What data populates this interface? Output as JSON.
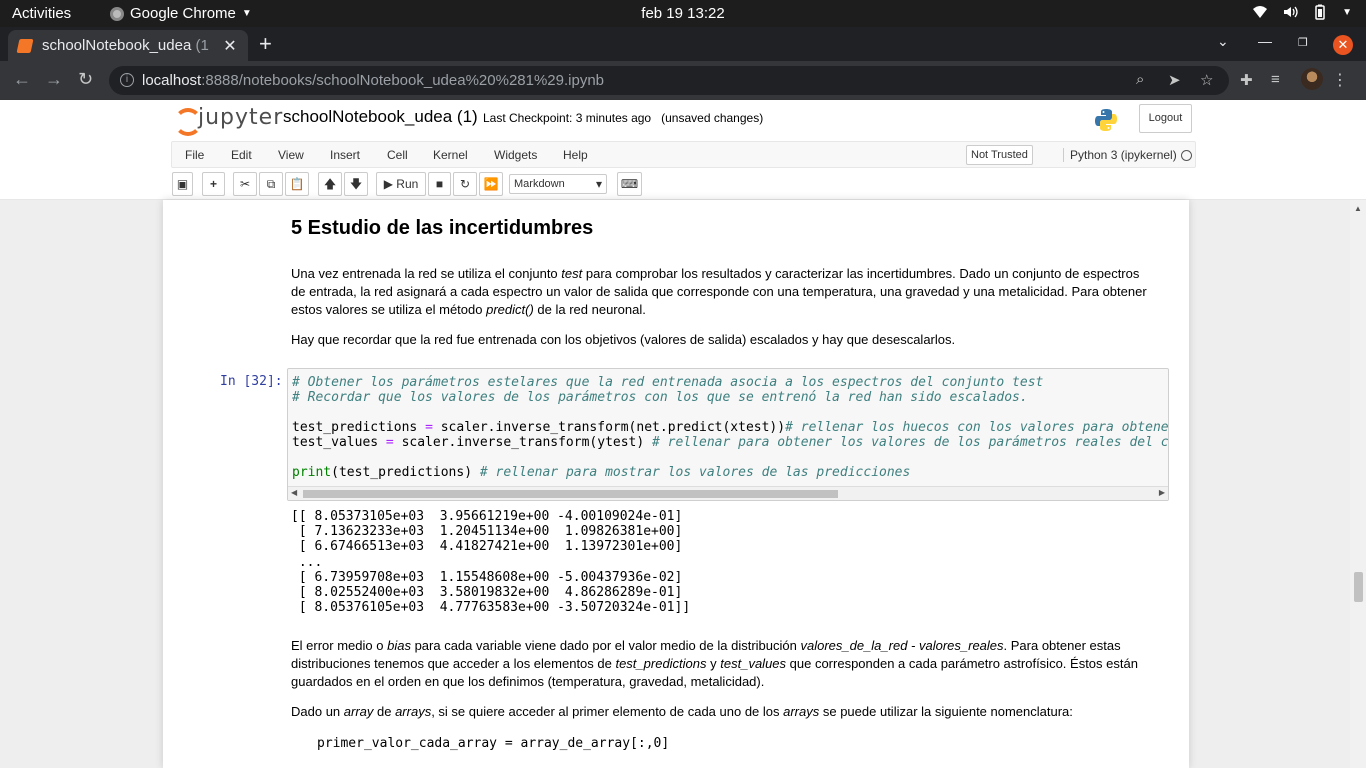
{
  "os": {
    "activities": "Activities",
    "app_name": "Google Chrome",
    "clock": "feb 19  13:22"
  },
  "browser": {
    "tab_title": "schoolNotebook_udea",
    "tab_title_dim": "(1",
    "url_host": "localhost",
    "url_path": ":8888/notebooks/schoolNotebook_udea%20%281%29.ipynb"
  },
  "jupyter": {
    "logo_word": "jupyter",
    "notebook_name": "schoolNotebook_udea (1)",
    "checkpoint": "Last Checkpoint: 3 minutes ago",
    "unsaved": "(unsaved changes)",
    "logout": "Logout",
    "menu": [
      "File",
      "Edit",
      "View",
      "Insert",
      "Cell",
      "Kernel",
      "Widgets",
      "Help"
    ],
    "not_trusted": "Not Trusted",
    "kernel": "Python 3 (ipykernel)",
    "run_label": "Run",
    "cell_type": "Markdown"
  },
  "notebook": {
    "heading": "5 Estudio de las incertidumbres",
    "p1_a": "Una vez entrenada la red se utiliza el conjunto ",
    "p1_em": "test",
    "p1_b": " para comprobar los resultados y caracterizar las incertidumbres. Dado un conjunto de espectros de entrada, la red asignará a cada espectro un valor de salida que corresponde con una temperatura, una gravedad y una metalicidad. Para obtener estos valores se utiliza el método ",
    "p1_em2": "predict()",
    "p1_c": " de la red neuronal.",
    "p2": "Hay que recordar que la red fue entrenada con los objetivos (valores de salida) escalados y hay que desescalarlos.",
    "prompt": "In [32]:",
    "code": {
      "l1": "# Obtener los parámetros estelares que la red entrenada asocia a los espectros del conjunto test",
      "l2": "# Recordar que los valores de los parámetros con los que se entrenó la red han sido escalados.",
      "l3a": "test_predictions ",
      "l3op": "=",
      "l3b": " scaler.inverse_transform(net.predict(xtest))",
      "l3c": "# rellenar los huecos con los valores para obtener la",
      "l4a": "test_values ",
      "l4op": "=",
      "l4b": " scaler.inverse_transform(ytest) ",
      "l4c": "# rellenar para obtener los valores de los parámetros reales del conju",
      "l5kw": "print",
      "l5b": "(test_predictions) ",
      "l5c": "# rellenar para mostrar los valores de las predicciones"
    },
    "output": [
      "[[ 8.05373105e+03  3.95661219e+00 -4.00109024e-01]",
      " [ 7.13623233e+03  1.20451134e+00  1.09826381e+00]",
      " [ 6.67466513e+03  4.41827421e+00  1.13972301e+00]",
      " ...",
      " [ 6.73959708e+03  1.15548608e+00 -5.00437936e-02]",
      " [ 8.02552400e+03  3.58019832e+00  4.86286289e-01]",
      " [ 8.05376105e+03  4.77763583e+00 -3.50720324e-01]]"
    ],
    "p3_a": "El error medio o ",
    "p3_em1": "bias",
    "p3_b": " para cada variable viene dado por el valor medio de la distribución ",
    "p3_em2": "valores_de_la_red - valores_reales",
    "p3_c": ". Para obtener estas distribuciones tenemos que acceder a los elementos de ",
    "p3_em3": "test_predictions",
    "p3_d": " y ",
    "p3_em4": "test_values",
    "p3_e": " que corresponden a cada parámetro astrofísico. Éstos están guardados en el orden en que los definimos (temperatura, gravedad, metalicidad).",
    "p4_a": "Dado un ",
    "p4_em1": "array",
    "p4_b": " de ",
    "p4_em2": "arrays",
    "p4_c": ", si se quiere acceder al primer elemento de cada uno de los ",
    "p4_em3": "arrays",
    "p4_d": " se puede utilizar la siguiente nomenclatura:",
    "code2": "primer_valor_cada_array = array_de_array[:,0]"
  }
}
